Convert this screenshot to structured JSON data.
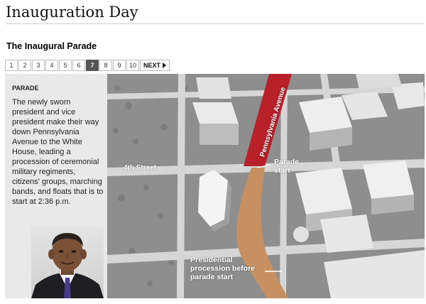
{
  "page": {
    "title": "Inauguration Day"
  },
  "section": {
    "title": "The Inaugural Parade"
  },
  "pager": {
    "pages": [
      "1",
      "2",
      "3",
      "4",
      "5",
      "6",
      "7",
      "8",
      "9",
      "10"
    ],
    "active": "7",
    "next_label": "NEXT"
  },
  "panel": {
    "label": "PARADE",
    "text": "The newly sworn president and vice president make their way down Pennsylvania Avenue to the White House, leading a procession of ceremonial military regiments, citizens' groups, marching bands, and floats that is to start at 2:36 p.m."
  },
  "map": {
    "street_label": "4th Street",
    "avenue_label": "Pennsylvania Avenue",
    "parade_start_label": "Parade\nstart",
    "procession_label": "Presidential\nprocession before\nparade start",
    "colors": {
      "avenue": "#b8202a",
      "route": "#c79060",
      "ground": "#8e8e8e",
      "roads": "#d6d6d6"
    }
  }
}
